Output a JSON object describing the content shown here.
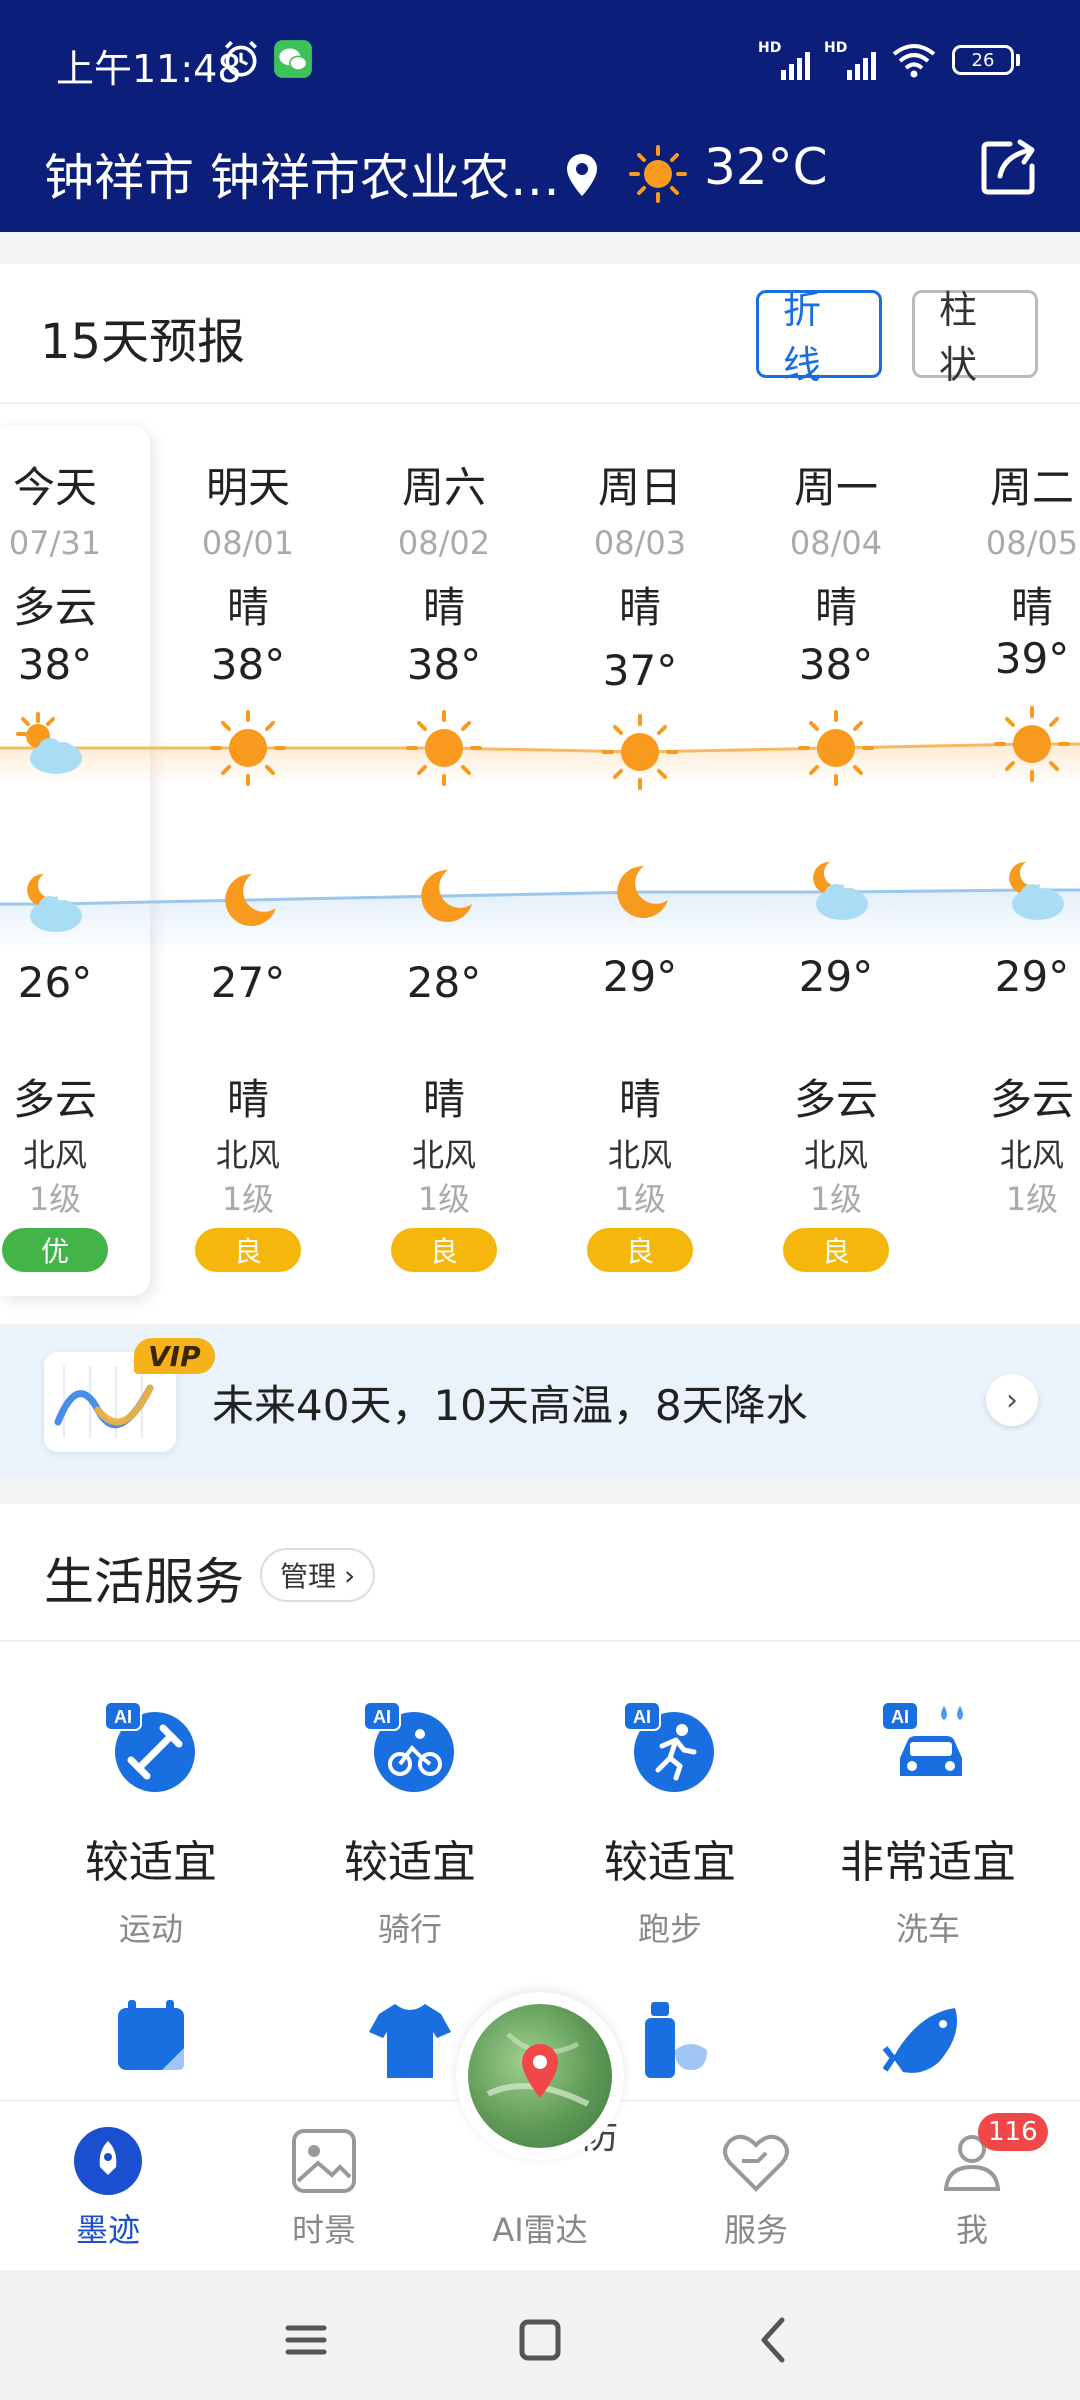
{
  "status_bar": {
    "time": "上午11:48",
    "battery": "26"
  },
  "header": {
    "location": "钟祥市 钟祥市农业农…",
    "temperature": "32°C"
  },
  "forecast": {
    "title": "15天预报",
    "toggle_line": "折线",
    "toggle_bar": "柱状",
    "days": [
      {
        "name": "今天",
        "date": "07/31",
        "day_cond": "多云",
        "high": "38°",
        "low": "26°",
        "night_cond": "多云",
        "wind_dir": "北风",
        "wind_level": "1级",
        "aqi": "优",
        "day_icon": "partly-cloudy-icon",
        "night_icon": "cloudy-night-icon"
      },
      {
        "name": "明天",
        "date": "08/01",
        "day_cond": "晴",
        "high": "38°",
        "low": "27°",
        "night_cond": "晴",
        "wind_dir": "北风",
        "wind_level": "1级",
        "aqi": "良",
        "day_icon": "sun-icon",
        "night_icon": "moon-icon"
      },
      {
        "name": "周六",
        "date": "08/02",
        "day_cond": "晴",
        "high": "38°",
        "low": "28°",
        "night_cond": "晴",
        "wind_dir": "北风",
        "wind_level": "1级",
        "aqi": "良",
        "day_icon": "sun-icon",
        "night_icon": "moon-icon"
      },
      {
        "name": "周日",
        "date": "08/03",
        "day_cond": "晴",
        "high": "37°",
        "low": "29°",
        "night_cond": "晴",
        "wind_dir": "北风",
        "wind_level": "1级",
        "aqi": "良",
        "day_icon": "sun-icon",
        "night_icon": "moon-icon"
      },
      {
        "name": "周一",
        "date": "08/04",
        "day_cond": "晴",
        "high": "38°",
        "low": "29°",
        "night_cond": "多云",
        "wind_dir": "北风",
        "wind_level": "1级",
        "aqi": "良",
        "day_icon": "sun-icon",
        "night_icon": "cloudy-night-icon"
      },
      {
        "name": "周二",
        "date": "08/05",
        "day_cond": "晴",
        "high": "39°",
        "low": "29°",
        "night_cond": "多云",
        "wind_dir": "北风",
        "wind_level": "1级",
        "aqi": "",
        "day_icon": "sun-icon",
        "night_icon": "cloudy-night-icon"
      }
    ],
    "colors": {
      "aqi_good": "#43b449",
      "aqi_fair": "#f5b70c",
      "high_line": "#f7b863",
      "low_line": "#9cc7ea",
      "accent": "#1a6fe0"
    }
  },
  "vip": {
    "badge": "VIP",
    "text": "未来40天，10天高温，8天降水"
  },
  "life": {
    "title": "生活服务",
    "manage": "管理",
    "services": [
      {
        "value": "较适宜",
        "label": "运动",
        "icon": "dumbbell-icon"
      },
      {
        "value": "较适宜",
        "label": "骑行",
        "icon": "cycling-icon"
      },
      {
        "value": "较适宜",
        "label": "跑步",
        "icon": "running-icon"
      },
      {
        "value": "非常适宜",
        "label": "洗车",
        "icon": "car-wash-icon"
      }
    ]
  },
  "nav": {
    "items": [
      {
        "label": "墨迹",
        "icon": "moji-icon"
      },
      {
        "label": "时景",
        "icon": "gallery-icon"
      },
      {
        "label": "AI雷达",
        "icon": "radar-icon"
      },
      {
        "label": "服务",
        "icon": "service-icon"
      },
      {
        "label": "我",
        "icon": "profile-icon"
      }
    ],
    "badge": "116",
    "partial_label": "防"
  }
}
